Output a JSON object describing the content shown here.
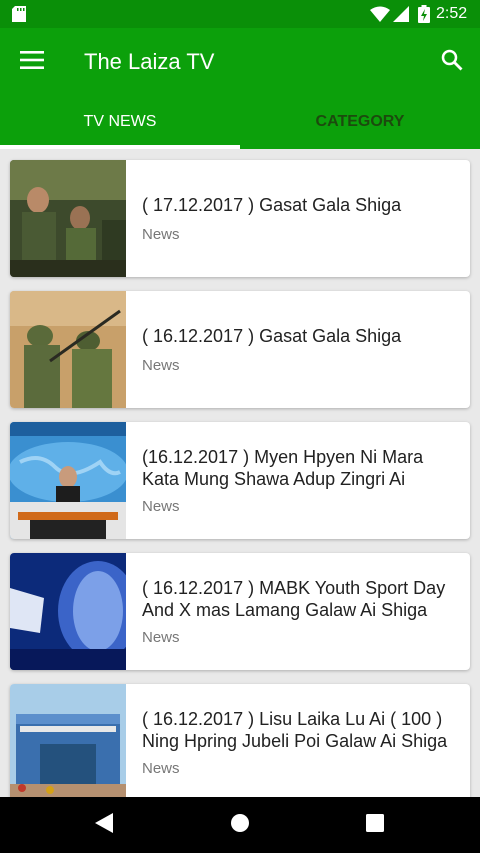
{
  "status": {
    "time": "2:52"
  },
  "app": {
    "title": "The Laiza TV"
  },
  "tabs": [
    {
      "label": "TV NEWS",
      "active": true
    },
    {
      "label": "CATEGORY",
      "active": false
    }
  ],
  "items": [
    {
      "title": "( 17.12.2017 ) Gasat Gala Shiga",
      "category": "News"
    },
    {
      "title": "( 16.12.2017 ) Gasat Gala Shiga",
      "category": "News"
    },
    {
      "title": " (16.12.2017 ) Myen Hpyen Ni Mara Kata Mung Shawa Adup Zingri Ai",
      "category": "News"
    },
    {
      "title": " ( 16.12.2017 ) MABK Youth Sport Day And X mas Lamang Galaw Ai Shiga",
      "category": "News"
    },
    {
      "title": "( 16.12.2017 ) Lisu Laika Lu Ai ( 100 ) Ning Hpring Jubeli Poi Galaw Ai Shiga",
      "category": "News"
    }
  ],
  "colors": {
    "status_bar": "#0a8f08",
    "app_bar": "#0ca00b",
    "category_tab_text": "#1c4a0e",
    "background": "#e9e9e9"
  },
  "icons": [
    "sd-card-icon",
    "wifi-icon",
    "signal-icon",
    "battery-icon",
    "menu-icon",
    "search-icon",
    "back-icon",
    "home-icon",
    "recents-icon"
  ]
}
